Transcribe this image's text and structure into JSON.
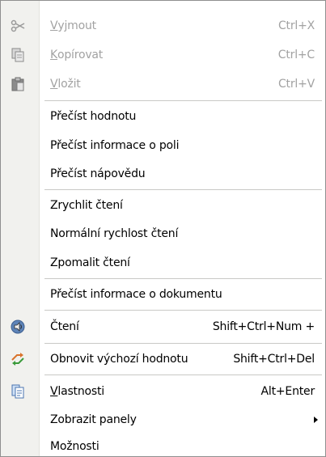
{
  "menu": {
    "items": {
      "cut": {
        "u": "V",
        "label_rest": "yjmout",
        "shortcut": "Ctrl+X"
      },
      "copy": {
        "u": "K",
        "label_rest": "opírovat",
        "shortcut": "Ctrl+C"
      },
      "paste": {
        "u": "V",
        "label_rest": "ložit",
        "shortcut": "Ctrl+V"
      },
      "read_value": {
        "label": "Přečíst hodnotu"
      },
      "read_field_info": {
        "label": "Přečíst informace o poli"
      },
      "read_help": {
        "label": "Přečíst nápovědu"
      },
      "speed_up": {
        "label": "Zrychlit čtení"
      },
      "normal_speed": {
        "label": "Normální rychlost čtení"
      },
      "slow_down": {
        "label": "Zpomalit čtení"
      },
      "read_doc_info": {
        "label": "Přečíst informace o dokumentu"
      },
      "reading": {
        "label": "Čtení",
        "shortcut": "Shift+Ctrl+Num +"
      },
      "restore_default": {
        "label": "Obnovit výchozí hodnotu",
        "shortcut": "Shift+Ctrl+Del"
      },
      "properties": {
        "u": "V",
        "label_rest": "lastnosti",
        "shortcut": "Alt+Enter"
      },
      "show_panels": {
        "label": "Zobrazit panely"
      },
      "options": {
        "label": "Možnosti"
      }
    },
    "icons": {
      "cut": "scissors-icon",
      "copy": "copy-icon",
      "paste": "paste-icon",
      "reading": "speaker-icon",
      "restore_default": "restore-icon",
      "properties": "properties-icon"
    },
    "colors": {
      "disabled_text": "#a2a2a2",
      "icon_strip": "#f1f1ee",
      "separator": "#c9c9c6"
    }
  }
}
